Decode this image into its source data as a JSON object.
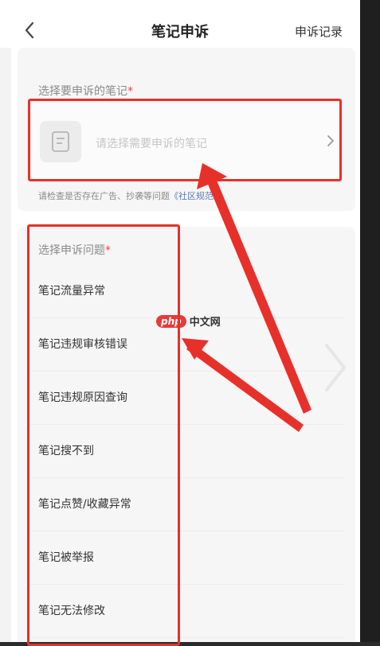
{
  "header": {
    "title": "笔记申诉",
    "record_link": "申诉记录"
  },
  "note_select": {
    "label": "选择要申诉的笔记",
    "required_mark": "*",
    "placeholder": "请选择需要申诉的笔记",
    "hint_prefix": "请检查是否存在广告、抄袭等问题",
    "hint_link": "《社区规范》"
  },
  "issue_select": {
    "label": "选择申诉问题",
    "required_mark": "*",
    "items": [
      "笔记流量异常",
      "笔记违规审核错误",
      "笔记违规原因查询",
      "笔记搜不到",
      "笔记点赞/收藏异常",
      "笔记被举报",
      "笔记无法修改"
    ]
  },
  "watermark": {
    "badge": "php",
    "text": "中文网"
  },
  "colors": {
    "highlight": "#e8302a",
    "required": "#ff3b3b",
    "link": "#5b7bb8"
  }
}
